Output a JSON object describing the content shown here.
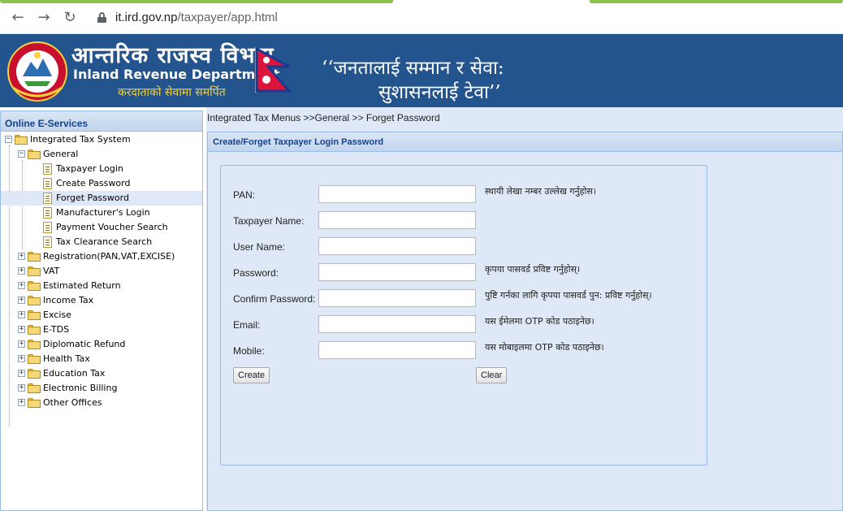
{
  "browser": {
    "url_host": "it.ird.gov.np",
    "url_path": "/taxpayer/app.html"
  },
  "banner": {
    "title_np": "आन्तरिक राजस्व विभाग",
    "title_en": "Inland Revenue Department",
    "motto": "करदाताको सेवामा समर्पित",
    "slogan_line1": "‘‘जनतालाई सम्मान र सेवा:",
    "slogan_line2": "सुशासनलाई टेवा’’",
    "color": "#24548d"
  },
  "sidebar": {
    "title": "Online E-Services",
    "root": "Integrated Tax System",
    "general": "General",
    "general_items": [
      "Taxpayer Login",
      "Create Password",
      "Forget Password",
      "Manufacturer's Login",
      "Payment Voucher Search",
      "Tax Clearance Search"
    ],
    "selected": "Forget Password",
    "folders": [
      "Registration(PAN,VAT,EXCISE)",
      "VAT",
      "Estimated Return",
      "Income Tax",
      "Excise",
      "E-TDS",
      "Diplomatic Refund",
      "Health Tax",
      "Education Tax",
      "Electronic Billing",
      "Other Offices"
    ]
  },
  "main": {
    "breadcrumb": "Integrated Tax Menus >>General >> Forget Password",
    "panel_title": "Create/Forget Taxpayer Login Password",
    "fields": [
      {
        "label": "PAN:",
        "value": "",
        "hint": "स्थायी लेखा नम्बर उल्लेख गर्नुहोस।"
      },
      {
        "label": "Taxpayer Name:",
        "value": "",
        "hint": ""
      },
      {
        "label": "User Name:",
        "value": "",
        "hint": ""
      },
      {
        "label": "Password:",
        "value": "",
        "hint": "कृपया पासवर्ड प्रविष्ट गर्नुहोस्।"
      },
      {
        "label": "Confirm Password:",
        "value": "",
        "hint": "पुष्टि गर्नका लागि कृपया पासवर्ड पुन: प्रविष्ट गर्नुहोस्।"
      },
      {
        "label": "Email:",
        "value": "",
        "hint": "यस ईमेलमा OTP कोड पठाइनेछ।"
      },
      {
        "label": "Mobile:",
        "value": "",
        "hint": "यस मोबाइलमा OTP कोड पठाइनेछ।"
      }
    ],
    "create_label": "Create",
    "clear_label": "Clear"
  }
}
